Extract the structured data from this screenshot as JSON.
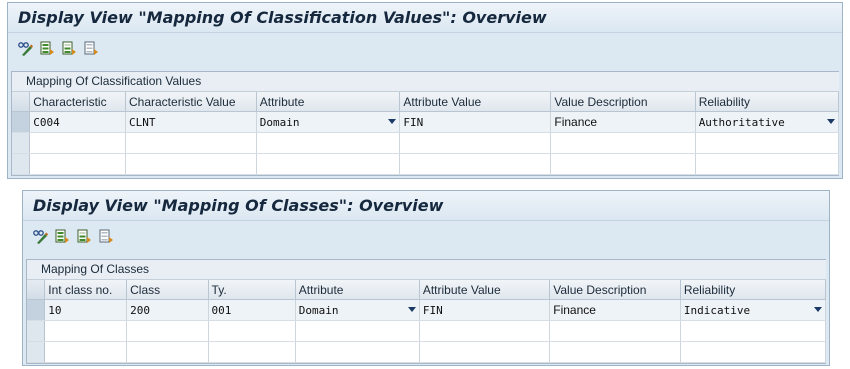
{
  "windows": [
    {
      "title": "Display View \"Mapping Of Classification Values\": Overview",
      "table_title": "Mapping Of Classification Values",
      "columns": [
        "Characteristic",
        "Characteristic Value",
        "Attribute",
        "Attribute Value",
        "Value Description",
        "Reliability"
      ],
      "rows": [
        {
          "characteristic": "C004",
          "characteristic_value": "CLNT",
          "attribute": "Domain",
          "attribute_value": "FIN",
          "value_description": "Finance",
          "reliability": "Authoritative"
        }
      ]
    },
    {
      "title": "Display View \"Mapping Of Classes\": Overview",
      "table_title": "Mapping Of Classes",
      "columns": [
        "Int class no.",
        "Class",
        "Ty.",
        "Attribute",
        "Attribute Value",
        "Value Description",
        "Reliability"
      ],
      "rows": [
        {
          "int_class_no": "10",
          "class": "200",
          "ty": "001",
          "attribute": "Domain",
          "attribute_value": "FIN",
          "value_description": "Finance",
          "reliability": "Indicative"
        }
      ]
    }
  ],
  "toolbar_icons": [
    "display-change-icon",
    "select-all-icon",
    "select-block-icon",
    "deselect-all-icon"
  ],
  "colors": {
    "window_bg": "#dce8f2",
    "header_bg": "#e3eaf0",
    "title_text": "#16283e"
  }
}
